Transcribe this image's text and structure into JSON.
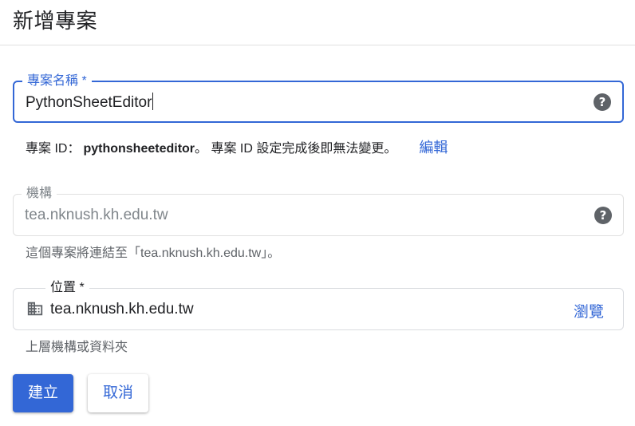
{
  "header": {
    "title": "新增專案"
  },
  "project_name": {
    "label": "專案名稱 *",
    "value": "PythonSheetEditor",
    "help_icon": "help-circle-icon"
  },
  "project_id": {
    "label": "專案 ID：",
    "value": "pythonsheeteditor",
    "note": "。 專案 ID 設定完成後即無法變更。",
    "edit_label": "編輯"
  },
  "organization": {
    "label": "機構",
    "value": "tea.nknush.kh.edu.tw",
    "help_icon": "help-circle-icon",
    "hint": "這個專案將連結至「tea.nknush.kh.edu.tw」。"
  },
  "location": {
    "label": "位置 *",
    "value": "tea.nknush.kh.edu.tw",
    "icon": "building-icon",
    "browse_label": "瀏覽",
    "hint": "上層機構或資料夾"
  },
  "actions": {
    "create_label": "建立",
    "cancel_label": "取消"
  },
  "colors": {
    "accent": "#3367d6",
    "muted": "#5f6368"
  }
}
